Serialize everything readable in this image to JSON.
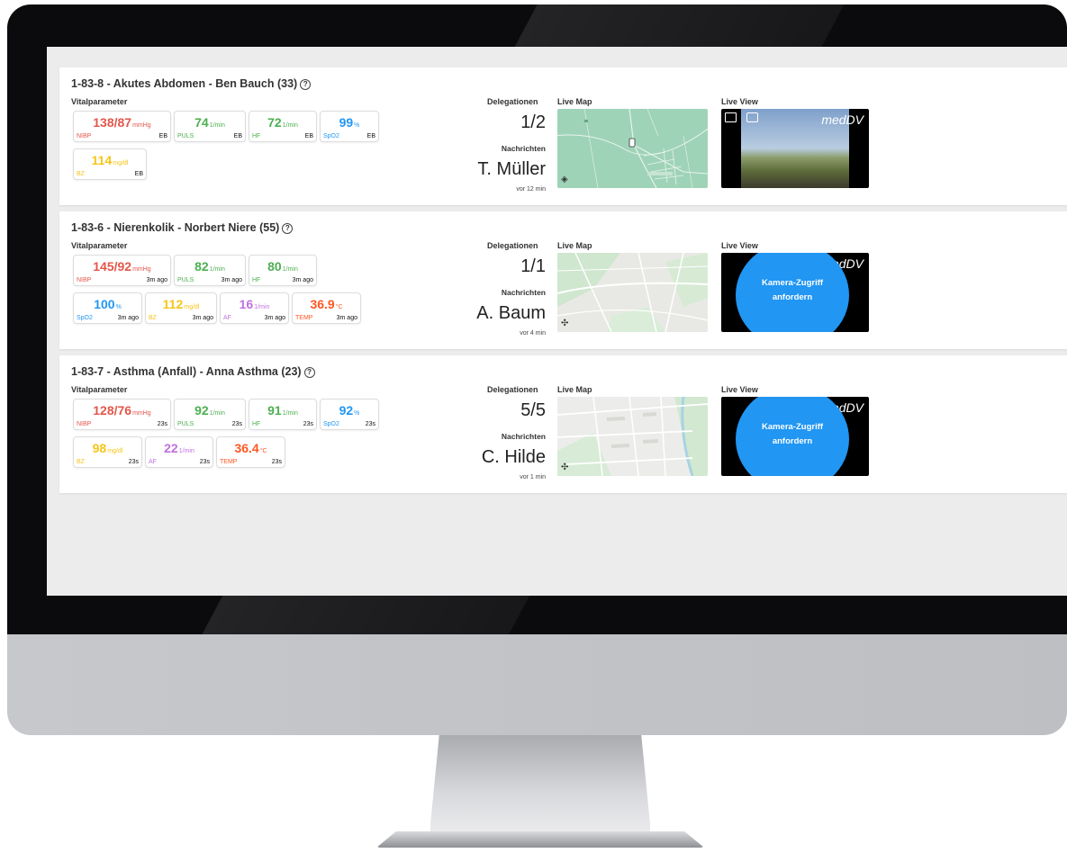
{
  "brand": {
    "logo_text": "medDV"
  },
  "common": {
    "vitals_heading": "Vitalparameter",
    "delegations_heading": "Delegationen",
    "messages_heading": "Nachrichten",
    "live_map_heading": "Live Map",
    "live_view_heading": "Live View",
    "camera_request_label": "Kamera-Zugriff\nanfordern",
    "help_icon": "?"
  },
  "colors": {
    "nibp": "#e2574c",
    "puls": "#4caf50",
    "hf": "#4caf50",
    "spo2": "#2196f3",
    "bz": "#f5c518",
    "af": "#c070e0",
    "temp": "#ff5722",
    "camera_button": "#2196f3"
  },
  "patients": [
    {
      "title": "1-83-8 - Akutes Abdomen - Ben Bauch (33)",
      "vitals": [
        {
          "value": "138/87",
          "unit": "mmHg",
          "label": "NIBP",
          "meta": "EB"
        },
        {
          "value": "74",
          "unit": "1/min",
          "label": "PULS",
          "meta": "EB"
        },
        {
          "value": "72",
          "unit": "1/min",
          "label": "HF",
          "meta": "EB"
        },
        {
          "value": "99",
          "unit": "%",
          "label": "SpO2",
          "meta": "EB"
        },
        {
          "value": "114",
          "unit": "mg/dl",
          "label": "BZ",
          "meta": "EB"
        }
      ],
      "delegations": "1/2",
      "person": "T. Müller",
      "time_ago": "vor 12 min",
      "live_view": "camera-image"
    },
    {
      "title": "1-83-6 - Nierenkolik - Norbert Niere (55)",
      "vitals": [
        {
          "value": "145/92",
          "unit": "mmHg",
          "label": "NIBP",
          "meta": "3m ago"
        },
        {
          "value": "82",
          "unit": "1/min",
          "label": "PULS",
          "meta": "3m ago"
        },
        {
          "value": "80",
          "unit": "1/min",
          "label": "HF",
          "meta": "3m ago"
        },
        {
          "value": "100",
          "unit": "%",
          "label": "SpO2",
          "meta": "3m ago"
        },
        {
          "value": "112",
          "unit": "mg/dl",
          "label": "BZ",
          "meta": "3m ago"
        },
        {
          "value": "16",
          "unit": "1/min",
          "label": "AF",
          "meta": "3m ago"
        },
        {
          "value": "36.9",
          "unit": "°C",
          "label": "TEMP",
          "meta": "3m ago"
        }
      ],
      "delegations": "1/1",
      "person": "A. Baum",
      "time_ago": "vor 4 min",
      "live_view": "camera-request"
    },
    {
      "title": "1-83-7 - Asthma (Anfall) - Anna Asthma (23)",
      "vitals": [
        {
          "value": "128/76",
          "unit": "mmHg",
          "label": "NIBP",
          "meta": "23s"
        },
        {
          "value": "92",
          "unit": "1/min",
          "label": "PULS",
          "meta": "23s"
        },
        {
          "value": "91",
          "unit": "1/min",
          "label": "HF",
          "meta": "23s"
        },
        {
          "value": "92",
          "unit": "%",
          "label": "SpO2",
          "meta": "23s"
        },
        {
          "value": "98",
          "unit": "mg/dl",
          "label": "BZ",
          "meta": "23s"
        },
        {
          "value": "22",
          "unit": "1/min",
          "label": "AF",
          "meta": "23s"
        },
        {
          "value": "36.4",
          "unit": "°C",
          "label": "TEMP",
          "meta": "23s"
        }
      ],
      "delegations": "5/5",
      "person": "C. Hilde",
      "time_ago": "vor 1 min",
      "live_view": "camera-request"
    }
  ]
}
